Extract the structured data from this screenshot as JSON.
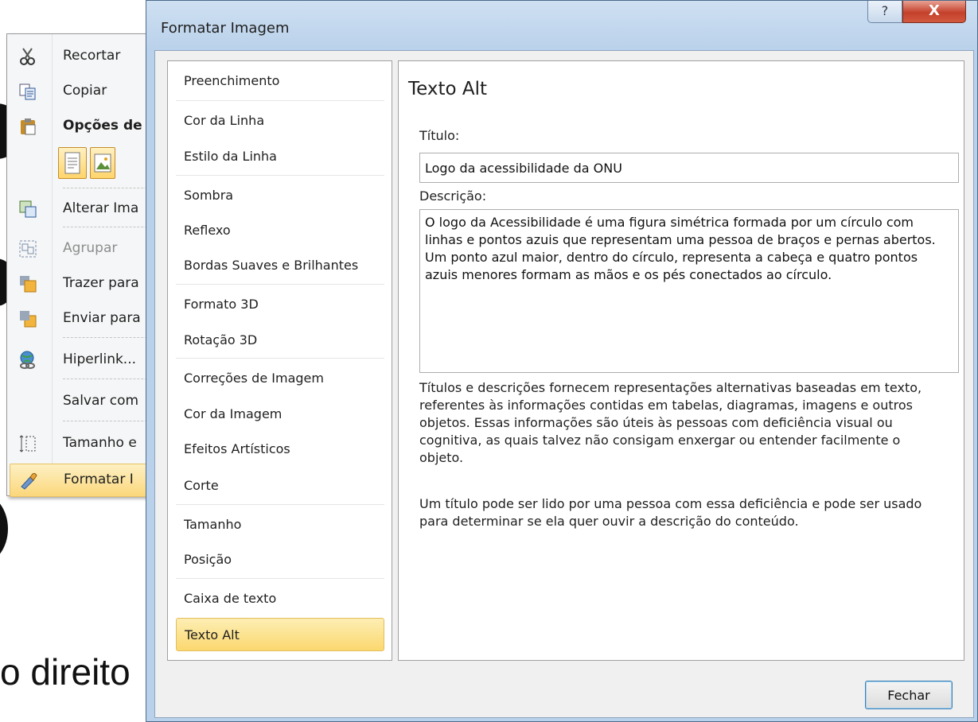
{
  "background": {
    "slide_text": "o direito"
  },
  "context_menu": {
    "items": [
      {
        "label": "Recortar",
        "icon": "scissors-icon",
        "mnemonic": "e"
      },
      {
        "label": "Copiar",
        "icon": "copy-icon",
        "mnemonic": "a"
      },
      {
        "label": "Opções de",
        "icon": "clipboard-icon"
      },
      {
        "label": "Alterar Ima",
        "icon": "change-picture-icon"
      },
      {
        "label": "Agrupar",
        "icon": "group-icon",
        "disabled": true
      },
      {
        "label": "Trazer para",
        "icon": "bring-forward-icon"
      },
      {
        "label": "Enviar para",
        "icon": "send-backward-icon"
      },
      {
        "label": "Hiperlink...",
        "icon": "hyperlink-globe-icon"
      },
      {
        "label": "Salvar com",
        "icon": ""
      },
      {
        "label": "Tamanho e",
        "icon": "size-icon"
      },
      {
        "label": "Formatar I",
        "icon": "format-picture-icon"
      }
    ]
  },
  "dialog": {
    "title": "Formatar Imagem",
    "help_glyph": "?",
    "close_glyph": "X",
    "nav": [
      "Preenchimento",
      "Cor da Linha",
      "Estilo da Linha",
      "Sombra",
      "Reflexo",
      "Bordas Suaves e Brilhantes",
      "Formato 3D",
      "Rotação 3D",
      "Correções de Imagem",
      "Cor da Imagem",
      "Efeitos Artísticos",
      "Corte",
      "Tamanho",
      "Posição",
      "Caixa de texto",
      "Texto Alt"
    ],
    "selected_nav": "Texto Alt",
    "panel": {
      "heading": "Texto Alt",
      "title_label": "Título:",
      "title_value": "Logo da acessibilidade da ONU",
      "description_label": "Descrição:",
      "description_value": "O logo da Acessibilidade é uma figura simétrica formada por um círculo com linhas e pontos azuis que representam uma pessoa de braços e pernas abertos. Um ponto azul maior, dentro do círculo, representa a cabeça e quatro pontos azuis menores formam as mãos e os pés conectados ao círculo.",
      "help_paragraph_1": "Títulos e descrições fornecem representações alternativas baseadas em texto, referentes às informações contidas em tabelas, diagramas, imagens e outros objetos. Essas informações são úteis às pessoas com deficiência visual ou cognitiva, as quais talvez não consigam enxergar ou entender facilmente o objeto.",
      "help_paragraph_2": "Um título pode ser lido por uma pessoa com essa deficiência e pode ser usado para determinar se ela quer ouvir a descrição do conteúdo."
    },
    "close_button_label": "Fechar"
  }
}
